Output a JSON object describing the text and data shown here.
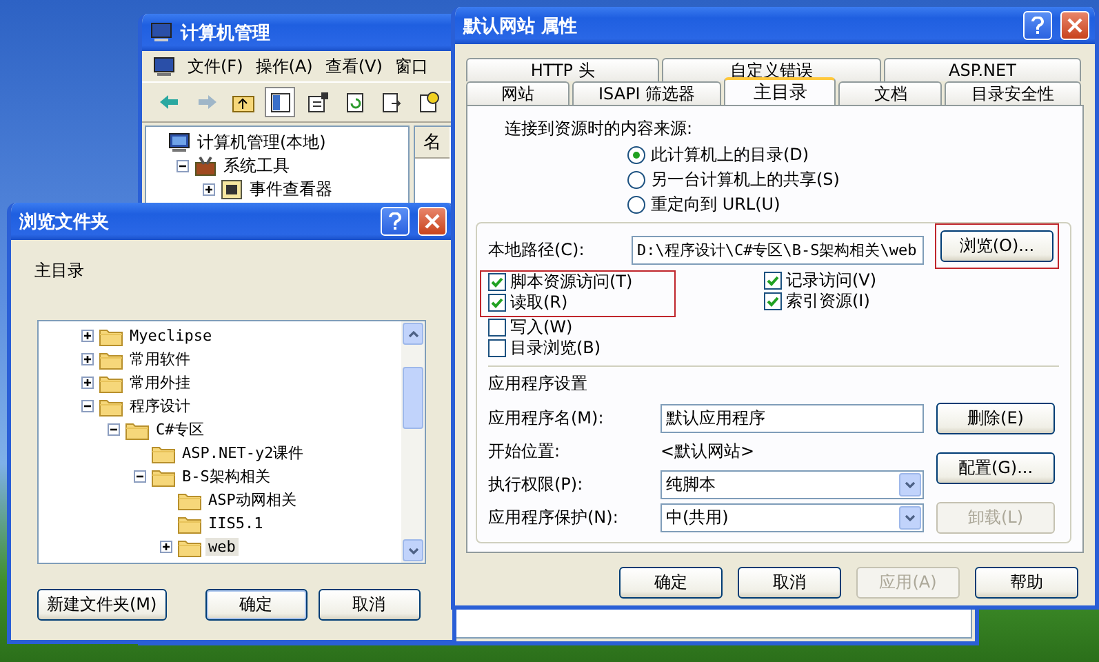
{
  "computer_management": {
    "title": "计算机管理",
    "menu": [
      "文件(F)",
      "操作(A)",
      "查看(V)",
      "窗口"
    ],
    "toolbar": [
      {
        "kind": "back",
        "pressed": false
      },
      {
        "kind": "forward",
        "pressed": false
      },
      {
        "kind": "up",
        "pressed": false
      },
      {
        "kind": "tree",
        "pressed": true
      },
      {
        "kind": "properties",
        "pressed": false
      },
      {
        "kind": "refresh",
        "pressed": false
      },
      {
        "kind": "export",
        "pressed": false
      },
      {
        "kind": "help",
        "pressed": false
      }
    ],
    "tree": [
      {
        "label": "计算机管理(本地)",
        "kind": "computer",
        "has_expander": false,
        "selected": false,
        "children": [
          {
            "label": "系统工具",
            "kind": "tools",
            "has_expander": true,
            "expanded": true,
            "selected": false,
            "children": [
              {
                "label": "事件查看器",
                "kind": "viewer",
                "has_expander": true,
                "expanded": false,
                "selected": false
              }
            ]
          }
        ]
      }
    ],
    "right_column_header": "名"
  },
  "browse_dialog": {
    "title": "浏览文件夹",
    "description": "主目录",
    "tree": [
      {
        "label": "Myeclipse",
        "has_expander": true,
        "expanded": false,
        "selected": false
      },
      {
        "label": "常用软件",
        "has_expander": true,
        "expanded": false,
        "selected": false
      },
      {
        "label": "常用外挂",
        "has_expander": true,
        "expanded": false,
        "selected": false
      },
      {
        "label": "程序设计",
        "has_expander": true,
        "expanded": true,
        "selected": false,
        "children": [
          {
            "label": "C#专区",
            "has_expander": true,
            "expanded": true,
            "selected": false,
            "children": [
              {
                "label": "ASP.NET-y2课件",
                "has_expander": false,
                "selected": false
              },
              {
                "label": "B-S架构相关",
                "has_expander": true,
                "expanded": true,
                "selected": false,
                "children": [
                  {
                    "label": "ASP动网相关",
                    "has_expander": false,
                    "selected": false
                  },
                  {
                    "label": "IIS5.1",
                    "has_expander": false,
                    "selected": false
                  },
                  {
                    "label": "web",
                    "has_expander": true,
                    "expanded": false,
                    "selected": true
                  }
                ]
              }
            ]
          }
        ]
      }
    ],
    "buttons": [
      {
        "label": "新建文件夹(M)",
        "default": false
      },
      {
        "label": "确定",
        "default": true
      },
      {
        "label": "取消",
        "default": false
      }
    ]
  },
  "properties_dialog": {
    "title": "默认网站 属性",
    "tab_rows": [
      [
        {
          "label": "HTTP 头",
          "selected": false
        },
        {
          "label": "自定义错误",
          "selected": false
        },
        {
          "label": "ASP.NET",
          "selected": false
        }
      ],
      [
        {
          "label": "网站",
          "selected": false
        },
        {
          "label": "ISAPI 筛选器",
          "selected": false
        },
        {
          "label": "主目录",
          "selected": true
        },
        {
          "label": "文档",
          "selected": false
        },
        {
          "label": "目录安全性",
          "selected": false
        }
      ]
    ],
    "source_label": "连接到资源时的内容来源:",
    "source_options": [
      {
        "label": "此计算机上的目录(D)",
        "selected": true
      },
      {
        "label": "另一台计算机上的共享(S)",
        "selected": false
      },
      {
        "label": "重定向到 URL(U)",
        "selected": false
      }
    ],
    "local_path": {
      "label": "本地路径(C):",
      "value": "D:\\程序设计\\C#专区\\B-S架构相关\\web",
      "button": {
        "label": "浏览(O)...",
        "highlighted": true
      }
    },
    "permissions_left": [
      {
        "label": "脚本资源访问(T)",
        "checked": true,
        "highlighted": true
      },
      {
        "label": "读取(R)",
        "checked": true,
        "highlighted": true
      },
      {
        "label": "写入(W)",
        "checked": false,
        "highlighted": false
      },
      {
        "label": "目录浏览(B)",
        "checked": false,
        "highlighted": false
      }
    ],
    "permissions_right": [
      {
        "label": "记录访问(V)",
        "checked": true,
        "highlighted": false
      },
      {
        "label": "索引资源(I)",
        "checked": true,
        "highlighted": false
      }
    ],
    "app_settings": {
      "heading": "应用程序设置",
      "name_label": "应用程序名(M):",
      "name_value": "默认应用程序",
      "start_label": "开始位置:",
      "start_value": "<默认网站>",
      "execute_label": "执行权限(P):",
      "execute_value": "纯脚本",
      "protection_label": "应用程序保护(N):",
      "protection_value": "中(共用)",
      "buttons": [
        {
          "label": "删除(E)",
          "disabled": false
        },
        {
          "label": "配置(G)...",
          "disabled": false
        },
        {
          "label": "卸载(L)",
          "disabled": true
        }
      ]
    },
    "buttons": [
      {
        "label": "确定",
        "disabled": false
      },
      {
        "label": "取消",
        "disabled": false
      },
      {
        "label": "应用(A)",
        "disabled": true
      },
      {
        "label": "帮助",
        "disabled": false
      }
    ]
  }
}
